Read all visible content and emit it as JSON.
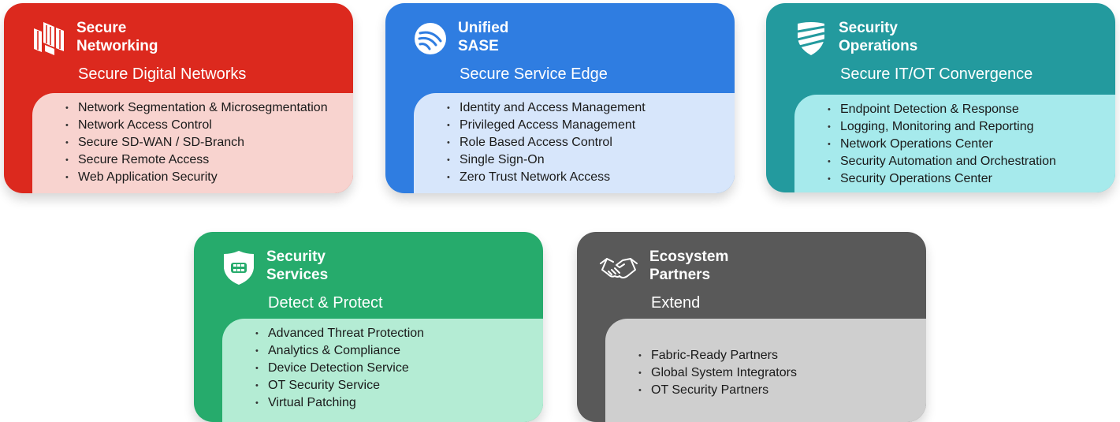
{
  "cards": [
    {
      "title_line1": "Secure",
      "title_line2": "Networking",
      "subtitle": "Secure Digital Networks",
      "icon": "network-segments-icon",
      "color": "#dc291e",
      "panel_color": "#f8d3cf",
      "items": [
        "Network Segmentation & Microsegmentation",
        "Network Access Control",
        "Secure SD-WAN / SD-Branch",
        "Secure Remote Access",
        "Web Application Security"
      ]
    },
    {
      "title_line1": "Unified",
      "title_line2": "SASE",
      "subtitle": "Secure Service Edge",
      "icon": "cloud-signal-icon",
      "color": "#2f7de1",
      "panel_color": "#d7e6fb",
      "items": [
        "Identity and Access Management",
        "Privileged Access Management",
        "Role Based Access Control",
        "Single Sign-On",
        "Zero Trust Network Access"
      ]
    },
    {
      "title_line1": "Security",
      "title_line2": "Operations",
      "subtitle": "Secure IT/OT Convergence",
      "icon": "shield-stripes-icon",
      "color": "#239a9e",
      "panel_color": "#a6eaec",
      "items": [
        "Endpoint Detection & Response",
        "Logging, Monitoring and Reporting",
        "Network Operations Center",
        "Security Automation and Orchestration",
        "Security Operations Center"
      ]
    },
    {
      "title_line1": "Security",
      "title_line2": "Services",
      "subtitle": "Detect & Protect",
      "icon": "shield-fabric-icon",
      "color": "#26ab6c",
      "panel_color": "#b4ecd4",
      "items": [
        "Advanced Threat Protection",
        "Analytics & Compliance",
        "Device Detection Service",
        "OT Security Service",
        "Virtual Patching"
      ]
    },
    {
      "title_line1": "Ecosystem",
      "title_line2": "Partners",
      "subtitle": "Extend",
      "icon": "handshake-icon",
      "color": "#595959",
      "panel_color": "#cfcfcf",
      "items": [
        "Fabric-Ready Partners",
        "Global System Integrators",
        "OT Security Partners"
      ]
    }
  ]
}
